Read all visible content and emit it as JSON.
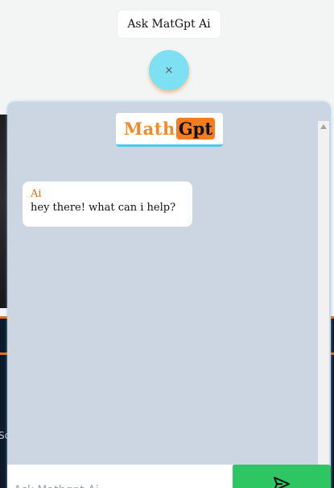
{
  "launcher": {
    "label": "Ask MatGpt Ai",
    "close_icon": "×"
  },
  "chat": {
    "logo": {
      "part1": "Math",
      "part2": "Gpt"
    },
    "messages": [
      {
        "sender": "Ai",
        "text": "hey there! what can i help?"
      }
    ],
    "input": {
      "value": "",
      "placeholder": "Ask Mathgpt Ai"
    },
    "send_icon": "send-icon"
  },
  "background": {
    "partial_text": "Sc"
  },
  "colors": {
    "panel_bg": "#ccd6e2",
    "accent_orange": "#f57d1f",
    "accent_cyan": "#7de1f3",
    "send_green": "#2ec563"
  }
}
